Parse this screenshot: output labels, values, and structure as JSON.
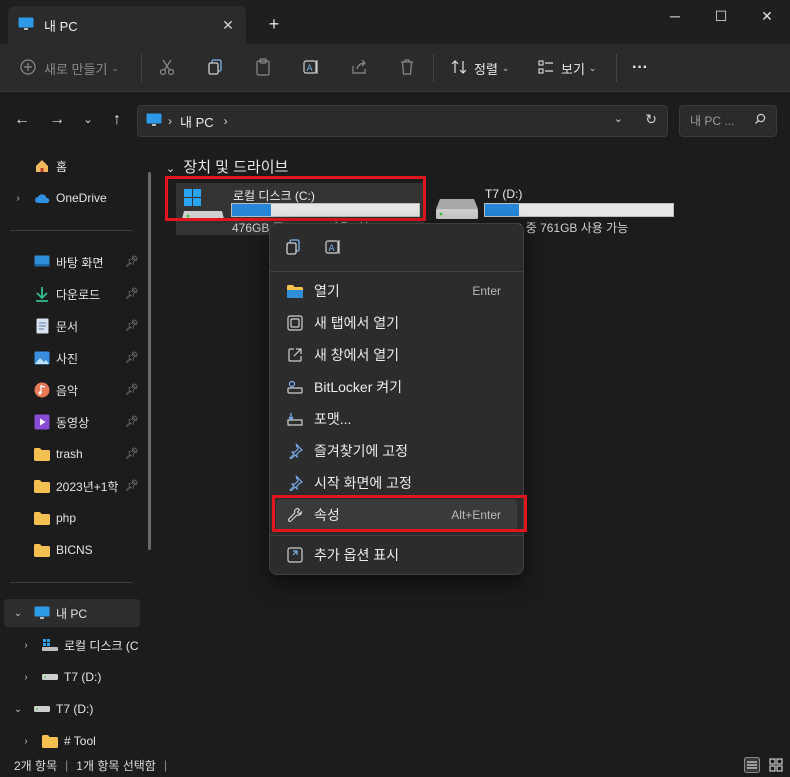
{
  "window": {
    "tab_title": "내 PC",
    "tab_close": "✕",
    "new_tab": "+",
    "minimize": "─",
    "maximize": "☐",
    "close": "✕"
  },
  "toolbar": {
    "new_label": "새로 만들기",
    "sort_label": "정렬",
    "view_label": "보기",
    "more_label": "···"
  },
  "address": {
    "path": "내 PC",
    "search_placeholder": "내 PC ..."
  },
  "sidebar": {
    "home": "홈",
    "onedrive": "OneDrive",
    "quick": [
      {
        "label": "바탕 화면"
      },
      {
        "label": "다운로드"
      },
      {
        "label": "문서"
      },
      {
        "label": "사진"
      },
      {
        "label": "음악"
      },
      {
        "label": "동영상"
      },
      {
        "label": "trash"
      },
      {
        "label": "2023년+1학"
      },
      {
        "label": "php"
      },
      {
        "label": "BICNS"
      }
    ],
    "this_pc": "내 PC",
    "local_disk": "로컬 디스크 (C",
    "t7_child": "T7 (D:)",
    "t7": "T7 (D:)",
    "tool": "# Tool"
  },
  "content": {
    "group_title": "장치 및 드라이브",
    "drives": [
      {
        "name": "로컬 디스크 (C:)",
        "size_text": "476GB 중 376GB 사용 가능",
        "used_fraction": 0.21
      },
      {
        "name": "T7 (D:)",
        "size_text": "931GB 중 761GB 사용 가능",
        "used_fraction": 0.18
      }
    ]
  },
  "context_menu": {
    "items": [
      {
        "label": "열기",
        "key": "Enter"
      },
      {
        "label": "새 탭에서 열기",
        "key": ""
      },
      {
        "label": "새 창에서 열기",
        "key": ""
      },
      {
        "label": "BitLocker 켜기",
        "key": ""
      },
      {
        "label": "포맷...",
        "key": ""
      },
      {
        "label": "즐겨찾기에 고정",
        "key": ""
      },
      {
        "label": "시작 화면에 고정",
        "key": ""
      },
      {
        "label": "속성",
        "key": "Alt+Enter"
      },
      {
        "label": "추가 옵션 표시",
        "key": ""
      }
    ]
  },
  "status": {
    "count": "2개 항목",
    "selected": "1개 항목 선택함",
    "sep": "|"
  },
  "colors": {
    "accent": "#2686d8",
    "highlight": "#e0151d",
    "background": "#1c1c1c"
  }
}
